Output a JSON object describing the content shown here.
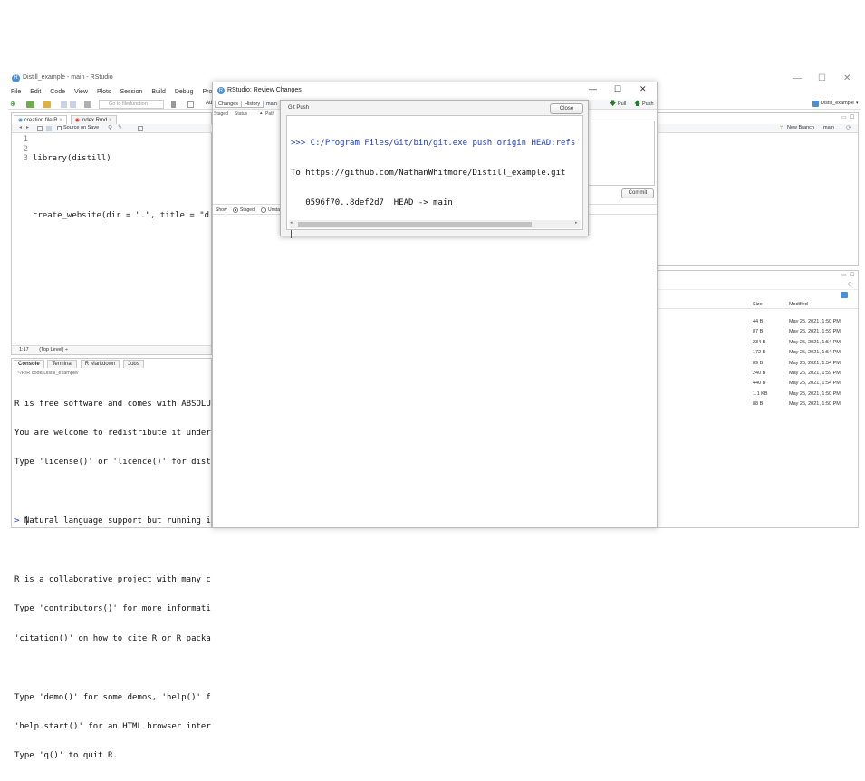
{
  "main_window": {
    "title": "Distill_example - main - RStudio",
    "controls": {
      "minimize": "—",
      "maximize": "☐",
      "close": "✕"
    },
    "menu": [
      "File",
      "Edit",
      "Code",
      "View",
      "Plots",
      "Session",
      "Build",
      "Debug",
      "Profile"
    ],
    "toolbar": {
      "goto_placeholder": "Go to file/function",
      "addins": "Ad",
      "project": "Distill_example"
    }
  },
  "editor": {
    "tabs": [
      "creation file.R",
      "index.Rmd"
    ],
    "source_on_save": "Source on Save",
    "line_numbers": [
      "1",
      "2",
      "3"
    ],
    "lines": [
      "library(distill)",
      "",
      "create_website(dir = \".\", title = \"d"
    ],
    "status_position": "1:17",
    "status_scope": "(Top Level) ÷"
  },
  "console": {
    "tabs": [
      "Console",
      "Terminal",
      "R Markdown",
      "Jobs"
    ],
    "path": "~/R/R code/Distill_example/",
    "lines": [
      "R is free software and comes with ABSOLU",
      "You are welcome to redistribute it under",
      "Type 'license()' or 'licence()' for dist",
      "",
      "  Natural language support but running i",
      "",
      "R is a collaborative project with many c",
      "Type 'contributors()' for more informati",
      "'citation()' on how to cite R or R packa",
      "",
      "Type 'demo()' for some demos, 'help()' f",
      "'help.start()' for an HTML browser inter",
      "Type 'q()' to quit R."
    ],
    "prompt": ">"
  },
  "review_dialog": {
    "title": "RStudio: Review Changes",
    "controls": {
      "minimize": "—",
      "maximize": "☐",
      "close": "✕"
    },
    "tabs": [
      "Changes",
      "History"
    ],
    "branch": "main",
    "columns": {
      "staged": "Staged",
      "status": "Status",
      "path": "Path"
    },
    "show_label": "Show",
    "staged_option": "Staged",
    "unstaged_option": "Unsta",
    "commit_button": "Commit",
    "pull_button": "Pull",
    "push_button": "Push"
  },
  "push_dialog": {
    "title": "Git Push",
    "close_button": "Close",
    "output_lines": [
      ">>> C:/Program Files/Git/bin/git.exe push origin HEAD:refs",
      "To https://github.com/NathanWhitmore/Distill_example.git",
      "   0596f70..8def2d7  HEAD -> main"
    ]
  },
  "git_pane": {
    "new_branch": "New Branch",
    "branch": "main"
  },
  "files_pane": {
    "columns": {
      "size": "Size",
      "modified": "Modified"
    },
    "rows": [
      {
        "size": "44 B",
        "modified": "May 25, 2021, 1:50 PM"
      },
      {
        "size": "87 B",
        "modified": "May 25, 2021, 1:59 PM"
      },
      {
        "size": "234 B",
        "modified": "May 25, 2021, 1:54 PM"
      },
      {
        "size": "172 B",
        "modified": "May 25, 2021, 1:54 PM"
      },
      {
        "size": "89 B",
        "modified": "May 25, 2021, 1:54 PM"
      },
      {
        "size": "240 B",
        "modified": "May 25, 2021, 1:59 PM"
      },
      {
        "size": "440 B",
        "modified": "May 25, 2021, 1:54 PM"
      },
      {
        "size": "1.1 KB",
        "modified": "May 25, 2021, 1:50 PM"
      },
      {
        "size": "88 B",
        "modified": "May 25, 2021, 1:50 PM"
      }
    ]
  },
  "colors": {
    "rstudio_blue": "#4a90d9",
    "console_blue": "#1a3cc8",
    "pane_border": "#c9c9c9",
    "pane_header": "#eef1f5"
  }
}
